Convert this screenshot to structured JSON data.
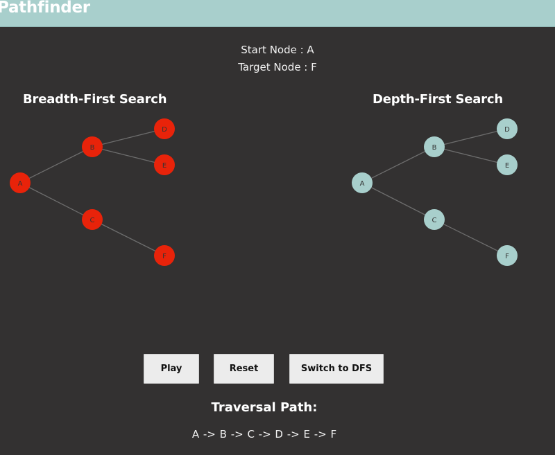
{
  "header": {
    "title": "Pathfinder"
  },
  "info": {
    "start_node": "Start Node : A",
    "target_node": "Target Node : F"
  },
  "colors": {
    "header_bg": "#a8cfcc",
    "bfs_node": "#e8230a",
    "dfs_node": "#a8cfcc",
    "page_bg": "#333131"
  },
  "bfs": {
    "title": "Breadth-First Search",
    "nodes": [
      {
        "id": "A",
        "label": "A"
      },
      {
        "id": "B",
        "label": "B"
      },
      {
        "id": "C",
        "label": "C"
      },
      {
        "id": "D",
        "label": "D"
      },
      {
        "id": "E",
        "label": "E"
      },
      {
        "id": "F",
        "label": "F"
      }
    ],
    "edges": [
      [
        "A",
        "B"
      ],
      [
        "A",
        "C"
      ],
      [
        "B",
        "D"
      ],
      [
        "B",
        "E"
      ],
      [
        "C",
        "F"
      ]
    ]
  },
  "dfs": {
    "title": "Depth-First Search",
    "nodes": [
      {
        "id": "A",
        "label": "A"
      },
      {
        "id": "B",
        "label": "B"
      },
      {
        "id": "C",
        "label": "C"
      },
      {
        "id": "D",
        "label": "D"
      },
      {
        "id": "E",
        "label": "E"
      },
      {
        "id": "F",
        "label": "F"
      }
    ],
    "edges": [
      [
        "A",
        "B"
      ],
      [
        "A",
        "C"
      ],
      [
        "B",
        "D"
      ],
      [
        "B",
        "E"
      ],
      [
        "C",
        "F"
      ]
    ]
  },
  "controls": {
    "play": "Play",
    "reset": "Reset",
    "switch": "Switch to DFS"
  },
  "traversal": {
    "title": "Traversal Path:",
    "path": "A -> B -> C -> D -> E -> F"
  }
}
